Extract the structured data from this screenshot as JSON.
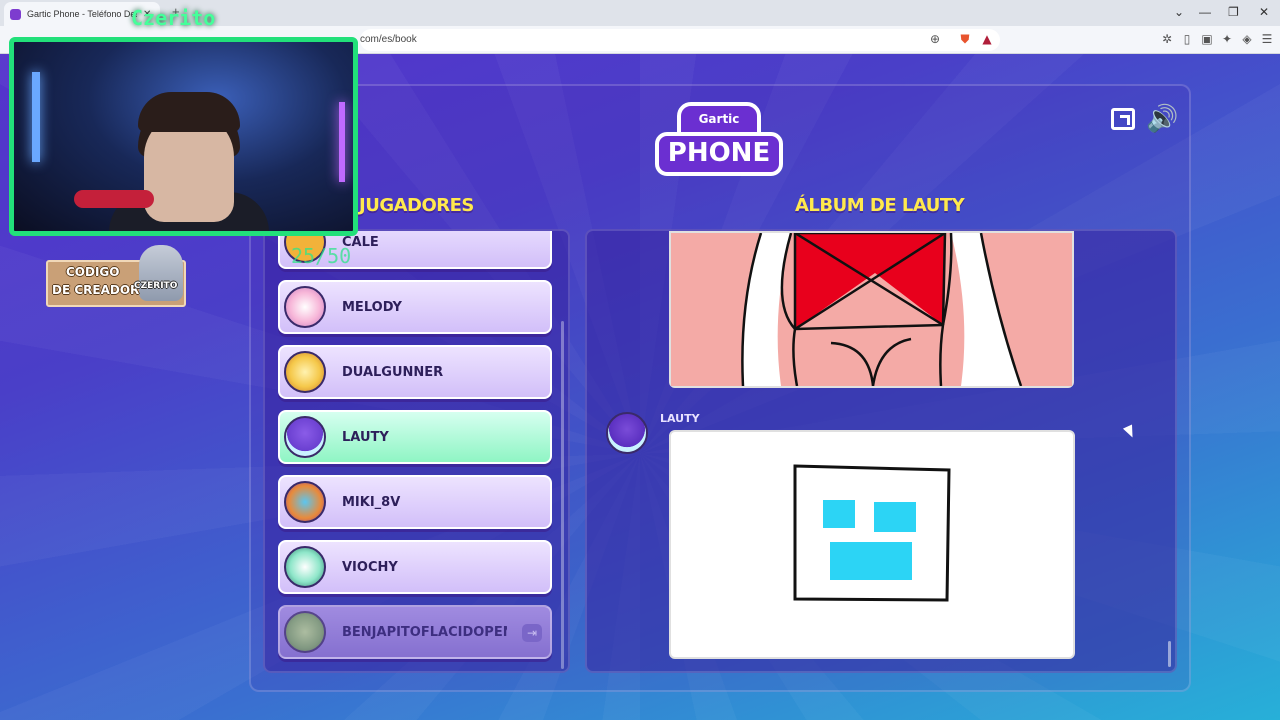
{
  "browser": {
    "tab_title": "Gartic Phone - Teléfono Descompuesto",
    "tab_close": "✕",
    "new_tab": "+",
    "url_visible": "com/es/book",
    "window_controls": [
      "⌄",
      "—",
      "❐",
      "✕"
    ]
  },
  "overlay": {
    "streamer_tag": "Czerito",
    "counter": "25/50",
    "creator_badge": {
      "line1": "CODIGO",
      "line2": "DE CREADOR",
      "name": "CZERITO"
    }
  },
  "game": {
    "logo_line1": "Gartic",
    "logo_line2": "PHONE",
    "players_heading": "JUGADORES",
    "album_heading": "ÁLBUM DE LAUTY",
    "players": [
      {
        "name": "CALE",
        "avatar_color": "#f2b23a"
      },
      {
        "name": "MELODY",
        "avatar_color": "#f7b6d8"
      },
      {
        "name": "DUALGUNNER",
        "avatar_color": "#f5c84a"
      },
      {
        "name": "LAUTY",
        "avatar_color": "#6a3fd0"
      },
      {
        "name": "MIKI_8V",
        "avatar_color": "#e98a3a"
      },
      {
        "name": "VIOCHY",
        "avatar_color": "#8ee6c9"
      },
      {
        "name": "BENJAPITOFLACIDOPENE",
        "avatar_color": "#7ea860"
      }
    ],
    "kick_icon": "⇥",
    "album_entry_author": "LAUTY",
    "colors": {
      "accent_yellow": "#ffe94d",
      "active_player": "#8ff5c4",
      "player_card": "#d2bff9",
      "drawing_red": "#e8001c",
      "drawing_pink": "#f4aaa6",
      "drawing_cyan": "#2cd4f5",
      "webcam_border": "#22e07a"
    }
  }
}
